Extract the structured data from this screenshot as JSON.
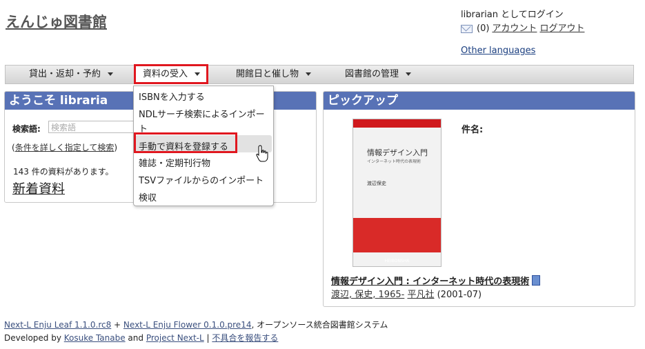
{
  "header": {
    "site_title": "えんじゅ図書館",
    "login_status": "librarian としてログイン",
    "message_count": "(0)",
    "account_link": "アカウント",
    "logout_link": "ログアウト",
    "other_languages": "Other languages"
  },
  "nav": {
    "items": [
      {
        "label": "貸出・返却・予約"
      },
      {
        "label": "資料の受入"
      },
      {
        "label": "開館日と催し物"
      },
      {
        "label": "図書館の管理"
      }
    ]
  },
  "dropdown": {
    "items": [
      {
        "label": "ISBNを入力する"
      },
      {
        "label": "NDLサーチ検索によるインポー"
      },
      {
        "label": "ト"
      },
      {
        "label": "手動で資料を登録する"
      },
      {
        "label": "雑誌・定期刊行物"
      },
      {
        "label": "TSVファイルからのインポート"
      },
      {
        "label": "検収"
      }
    ]
  },
  "welcome": {
    "heading": "ようこそ libraria",
    "search_label": "検索語:",
    "search_placeholder": "検索語",
    "advanced_search_open": "(",
    "advanced_search_link": "条件を詳しく指定して検索",
    "advanced_search_close": ")",
    "count_text": "143 件の資料があります。",
    "new_items": "新着資料"
  },
  "pickup": {
    "heading": "ピックアップ",
    "subject_label": "件名:",
    "cover": {
      "title": "情報デザイン入門",
      "subtitle": "インターネット時代の表現術",
      "author": "渡辺保史",
      "publisher": "HEIBONSHA"
    },
    "book_title": "情報デザイン入門 : インターネット時代の表現術",
    "author_link": "渡辺, 保史, 1965-",
    "publisher_link": "平凡社",
    "year": "(2001-07)"
  },
  "footer": {
    "leaf_link": "Next-L Enju Leaf 1.1.0.rc8",
    "plus": " + ",
    "flower_link": "Next-L Enju Flower 0.1.0.pre14",
    "tagline": ", オープンソース統合図書館システム",
    "developed_by": "Developed by ",
    "author_link": "Kosuke Tanabe",
    "and": " and ",
    "project_link": "Project Next-L",
    "separator": " | ",
    "report_link": "不具合を報告する"
  },
  "colors": {
    "panel_header": "#5872b6",
    "highlight_border": "#e0171f"
  }
}
